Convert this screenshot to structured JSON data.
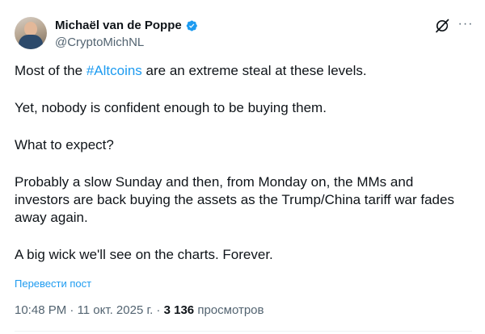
{
  "author": {
    "display_name": "Michaël van de Poppe",
    "handle": "@CryptoMichNL",
    "verified_icon": "verified-badge-icon",
    "verified_color": "#1d9bf0"
  },
  "actions": {
    "grok_icon": "grok-icon",
    "more_icon": "more-dots-icon",
    "more_symbol": "···"
  },
  "body": {
    "p1_before": "Most of the ",
    "p1_hashtag": "#Altcoins",
    "p1_after": " are an extreme steal at these levels.",
    "p2": "Yet, nobody is confident enough to be buying them.",
    "p3": "What to expect?",
    "p4": "Probably a slow Sunday and then, from Monday on, the MMs and investors are back buying the assets as the Trump/China tariff war fades away again.",
    "p5": "A big wick we'll see on the charts. Forever."
  },
  "translate_label": "Перевести пост",
  "meta": {
    "time": "10:48 PM",
    "sep1": " · ",
    "date": "11 окт. 2025 г.",
    "sep2": " · ",
    "views_count": "3 136",
    "views_label": " просмотров"
  },
  "colors": {
    "link": "#1d9bf0",
    "secondary_text": "#536471",
    "primary_text": "#0f1419"
  }
}
